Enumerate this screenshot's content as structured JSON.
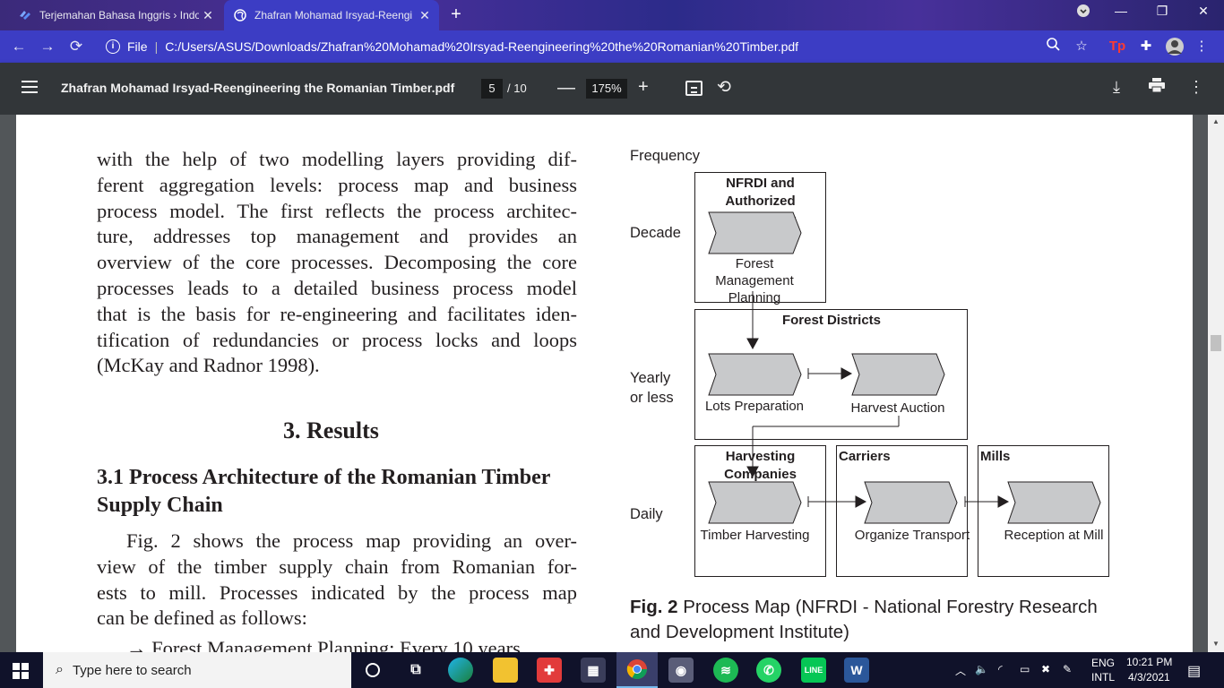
{
  "browser": {
    "tabs": [
      {
        "title": "Terjemahan Bahasa Inggris › Indo",
        "active": false
      },
      {
        "title": "Zhafran Mohamad Irsyad-Reengi",
        "active": true
      }
    ],
    "new_tab": "+",
    "window_controls": {
      "minimize": "—",
      "restore": "❐",
      "close": "✕"
    },
    "address": {
      "scheme_label": "File",
      "url": "C:/Users/ASUS/Downloads/Zhafran%20Mohamad%20Irsyad-Reengineering%20the%20Romanian%20Timber.pdf"
    }
  },
  "pdf_toolbar": {
    "title": "Zhafran Mohamad Irsyad-Reengineering the Romanian Timber.pdf",
    "page_current": "5",
    "page_total": "/ 10",
    "zoom": "175%",
    "zoom_minus": "—",
    "zoom_plus": "+"
  },
  "document": {
    "paragraph1": [
      "with the help of two modelling layers providing dif-",
      "ferent aggregation levels: process map and business",
      "process model. The first reflects the process architec-",
      "ture, addresses top management and provides an",
      "overview of the core processes. Decomposing the core",
      "processes leads to a detailed business process model",
      "that is the basis for re-engineering and facilitates iden-",
      "tification of redundancies or process locks and loops",
      "(McKay and Radnor 1998)."
    ],
    "section_heading": "3. Results",
    "subsection_heading": "3.1 Process Architecture of the Romanian Timber Supply Chain",
    "paragraph2": [
      "Fig. 2 shows the process map providing an over-",
      "view of the timber supply chain from Romanian for-",
      "ests to mill. Processes indicated by the process map",
      "can be defined as follows:"
    ],
    "paragraph3_partial": "→ Forest Management Planning: Every 10 years"
  },
  "diagram": {
    "frequency_label": "Frequency",
    "row_labels": {
      "decade": "Decade",
      "yearly": "Yearly or less",
      "daily": "Daily"
    },
    "boxes": {
      "nfrdi": "NFRDI and Authorized Companies",
      "districts": "Forest Districts",
      "harvesting": "Harvesting Companies",
      "carriers": "Carriers",
      "mills": "Mills"
    },
    "processes": {
      "fmp": "Forest Management Planning",
      "lots": "Lots Preparation",
      "auction": "Harvest Auction",
      "timber": "Timber Harvesting",
      "transport": "Organize Transport",
      "reception": "Reception at Mill"
    },
    "colors": {
      "chevron_fill": "#c8c9cb",
      "line": "#231f20"
    }
  },
  "caption": {
    "label": "Fig. 2",
    "text": "Process Map (NFRDI - National Forestry Research and Development Institute)"
  },
  "taskbar": {
    "search_placeholder": "Type here to search",
    "language_top": "ENG",
    "language_bottom": "INTL",
    "time": "10:21 PM",
    "date": "4/3/2021"
  }
}
